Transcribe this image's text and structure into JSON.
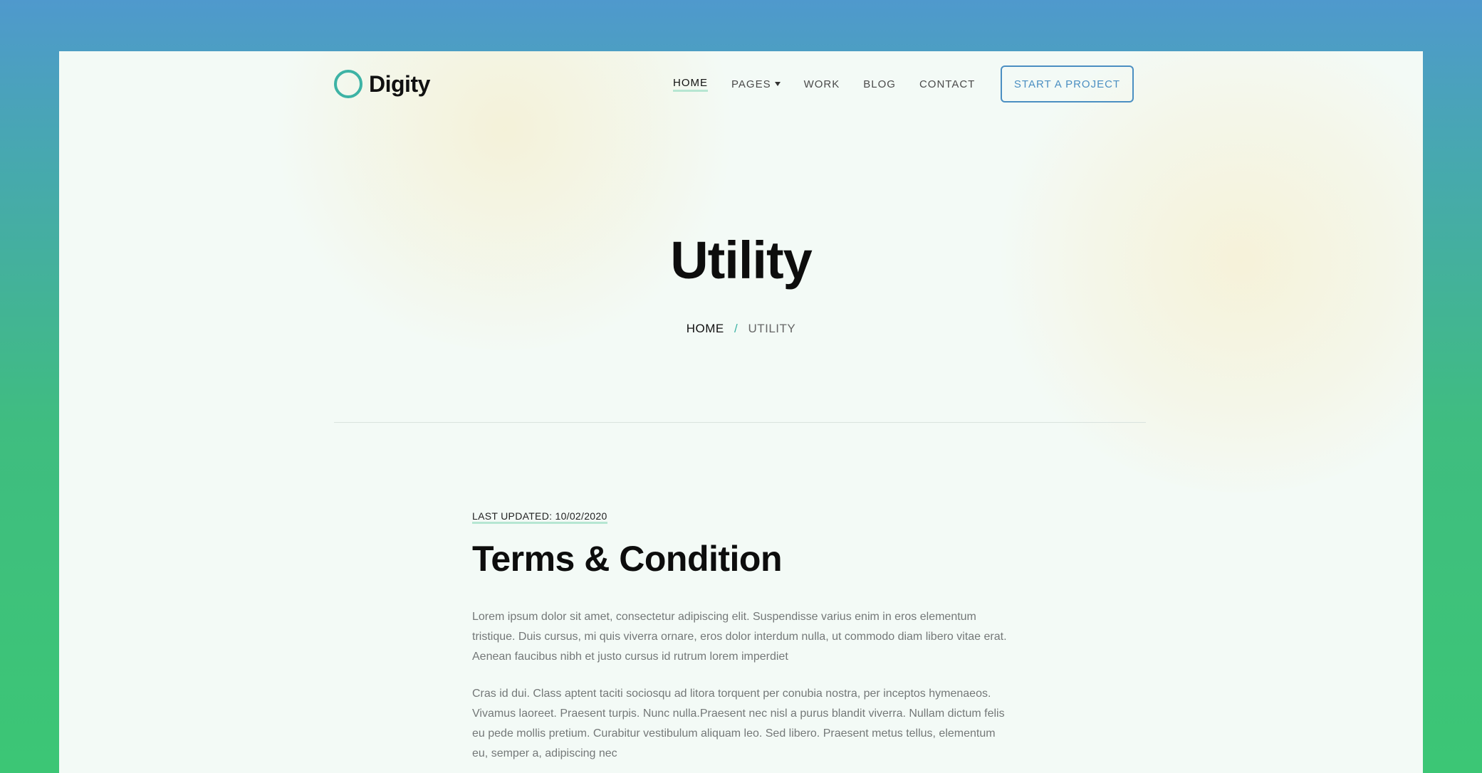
{
  "brand": {
    "name": "Digity",
    "ring_color": "#3db3a5"
  },
  "nav": {
    "items": [
      {
        "label": "HOME",
        "active": true
      },
      {
        "label": "PAGES",
        "has_dropdown": true
      },
      {
        "label": "WORK"
      },
      {
        "label": "BLOG"
      },
      {
        "label": "CONTACT"
      }
    ],
    "cta_label": "START A PROJECT",
    "cta_color": "#4b8fc2"
  },
  "hero": {
    "title": "Utility",
    "breadcrumb": {
      "home": "HOME",
      "separator": "/",
      "current": "UTILITY"
    }
  },
  "content": {
    "last_updated": "LAST UPDATED: 10/02/2020",
    "title": "Terms & Condition",
    "paragraphs": [
      "Lorem ipsum dolor sit amet, consectetur adipiscing elit. Suspendisse varius enim in eros elementum tristique. Duis cursus, mi quis viverra ornare, eros dolor interdum nulla, ut commodo diam libero vitae erat. Aenean faucibus nibh et justo cursus id rutrum lorem imperdiet",
      "Cras id dui. Class aptent taciti sociosqu ad litora torquent per conubia nostra, per inceptos hymenaeos. Vivamus laoreet. Praesent turpis. Nunc nulla.Praesent nec nisl a purus blandit viverra. Nullam dictum felis eu pede mollis pretium. Curabitur vestibulum aliquam leo. Sed libero. Praesent metus tellus, elementum eu, semper a, adipiscing nec"
    ]
  },
  "colors": {
    "accent": "#3db3a5",
    "underline": "#b6e6d2",
    "page_background": "#f3faf6"
  }
}
